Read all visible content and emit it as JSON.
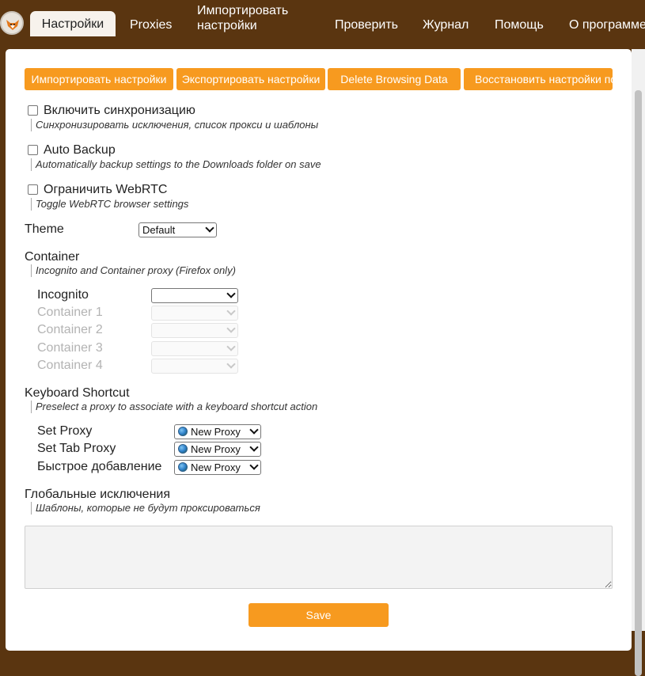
{
  "nav": {
    "tabs": [
      {
        "label": "Настройки"
      },
      {
        "label": "Proxies"
      },
      {
        "label_line1": "Импортировать",
        "label_line2": "настройки"
      },
      {
        "label": "Проверить"
      },
      {
        "label": "Журнал"
      },
      {
        "label": "Помощь"
      },
      {
        "label": "О программе"
      }
    ]
  },
  "toolbar": {
    "import_label": "Импортировать настройки",
    "export_label": "Экспортировать настройки",
    "delete_label": "Delete Browsing Data",
    "restore_label": "Восстановить настройки по умолчанию"
  },
  "options": {
    "sync": {
      "label": "Включить синхронизацию",
      "desc": "Синхронизировать исключения, список прокси и шаблоны"
    },
    "backup": {
      "label": "Auto Backup",
      "desc": "Automatically backup settings to the Downloads folder on save"
    },
    "webrtc": {
      "label": "Ограничить WebRTC",
      "desc": "Toggle WebRTC browser settings"
    }
  },
  "theme": {
    "label": "Theme",
    "value": "Default"
  },
  "container": {
    "title": "Container",
    "desc": "Incognito and Container proxy (Firefox only)",
    "rows": [
      {
        "label": "Incognito"
      },
      {
        "label": "Container 1"
      },
      {
        "label": "Container 2"
      },
      {
        "label": "Container 3"
      },
      {
        "label": "Container 4"
      }
    ]
  },
  "keyboard": {
    "title": "Keyboard Shortcut",
    "desc": "Preselect a proxy to associate with a keyboard shortcut action",
    "rows": [
      {
        "label": "Set Proxy",
        "value": "New Proxy"
      },
      {
        "label": "Set Tab Proxy",
        "value": "New Proxy"
      },
      {
        "label": "Быстрое добавление",
        "value": "New Proxy"
      }
    ]
  },
  "global": {
    "title": "Глобальные исключения",
    "desc": "Шаблоны, которые не будут проксироваться",
    "textarea_value": ""
  },
  "save_label": "Save",
  "colors": {
    "accent": "#f79a1f",
    "header": "#5a3510",
    "active_tab": "#f7f2ec"
  }
}
